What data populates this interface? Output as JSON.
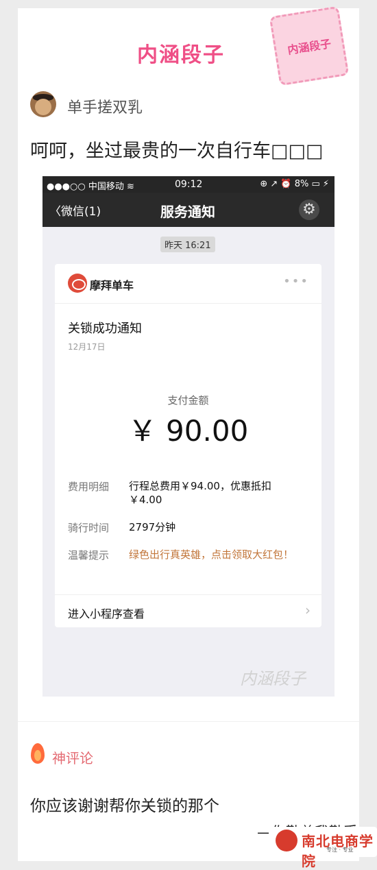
{
  "header": {
    "brand": "内涵段子",
    "stamp": "内涵段子"
  },
  "post": {
    "username": "单手搓双乳",
    "text": "呵呵，坐过最贵的一次自行车□□□"
  },
  "phone": {
    "status": {
      "carrier": "●●●○○ 中国移动 ≋",
      "time": "09:12",
      "battery": "⊕ ↗ ⏰ 8% ▭ ⚡"
    },
    "nav": {
      "back": "〈微信(1)",
      "title": "服务通知"
    },
    "timestamp": "昨天 16:21",
    "card": {
      "app_name": "摩拜单车",
      "notice_title": "关锁成功通知",
      "date": "12月17日",
      "pay_label": "支付金额",
      "pay_amount": "￥ 90.00",
      "rows": [
        {
          "label": "费用明细",
          "value": "行程总费用￥94.00，优惠抵扣￥4.00"
        },
        {
          "label": "骑行时间",
          "value": "2797分钟"
        },
        {
          "label": "温馨提示",
          "value": "绿色出行真英雄，点击领取大红包！"
        }
      ],
      "footer": "进入小程序查看"
    },
    "watermark": "内涵段子"
  },
  "comment": {
    "label": "神评论",
    "text": "你应该谢谢帮你关锁的那个",
    "signature": "—你勤兽我勤受"
  },
  "logo": {
    "name": "南北电商学院",
    "sub": "专注 · 专业"
  }
}
